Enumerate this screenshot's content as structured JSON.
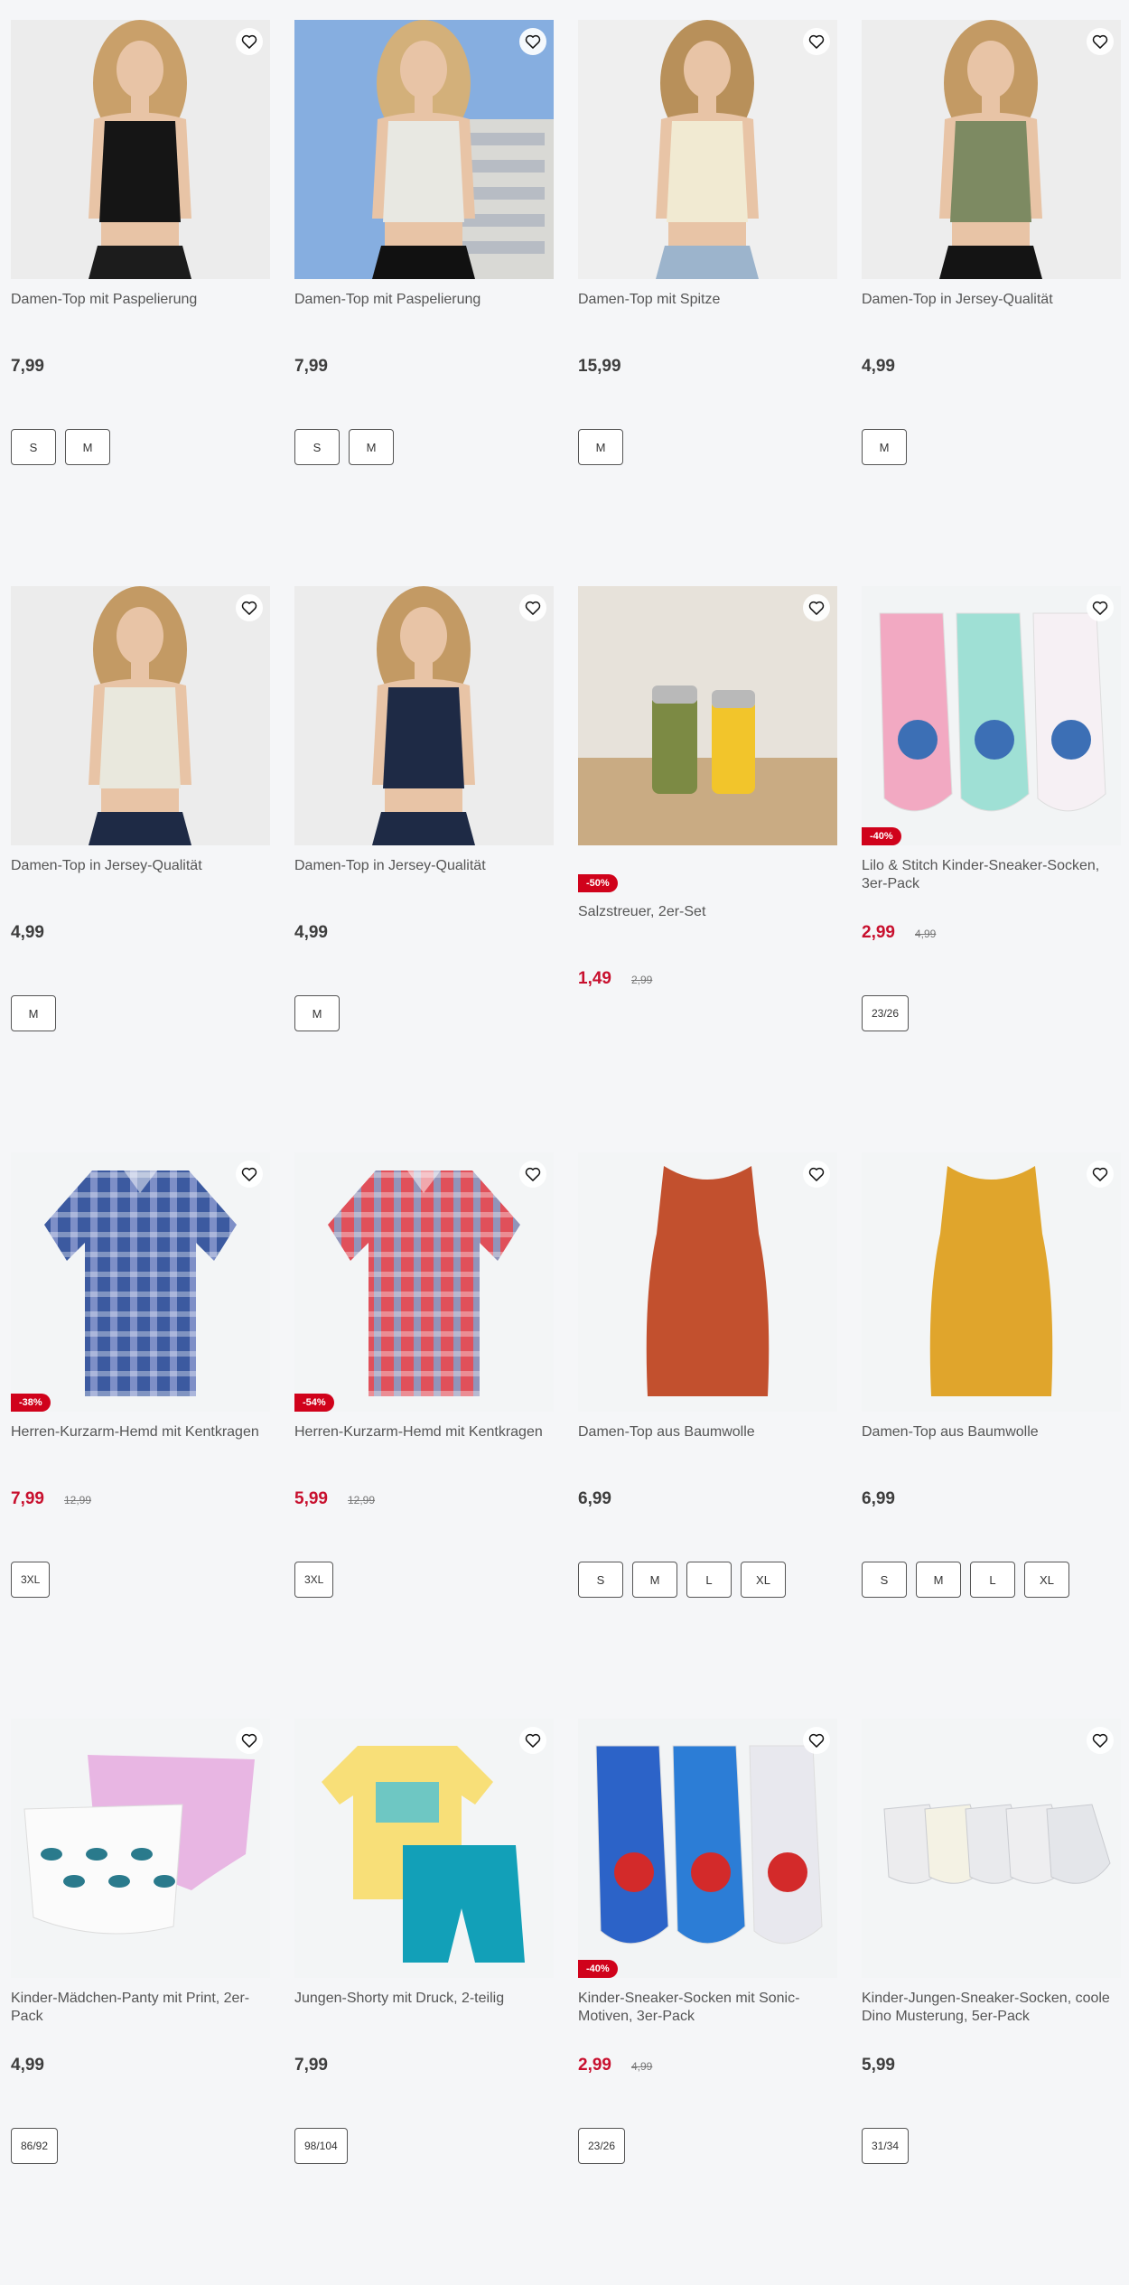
{
  "products": [
    {
      "name": "Damen-Top mit Paspelierung",
      "price": "7,99",
      "old_price": "",
      "discount": "",
      "sizes": [
        "S",
        "M"
      ],
      "image": "woman-black-crop-top"
    },
    {
      "name": "Damen-Top mit Paspelierung",
      "price": "7,99",
      "old_price": "",
      "discount": "",
      "sizes": [
        "S",
        "M"
      ],
      "image": "woman-white-crop-top-outdoor"
    },
    {
      "name": "Damen-Top mit Spitze",
      "price": "15,99",
      "old_price": "",
      "discount": "",
      "sizes": [
        "M"
      ],
      "image": "woman-lace-top-jeans"
    },
    {
      "name": "Damen-Top in Jersey-Qualität",
      "price": "4,99",
      "old_price": "",
      "discount": "",
      "sizes": [
        "M"
      ],
      "image": "woman-olive-crop-top"
    },
    {
      "name": "Damen-Top in Jersey-Qualität",
      "price": "4,99",
      "old_price": "",
      "discount": "",
      "sizes": [
        "M"
      ],
      "image": "woman-cream-crop-top"
    },
    {
      "name": "Damen-Top in Jersey-Qualität",
      "price": "4,99",
      "old_price": "",
      "discount": "",
      "sizes": [
        "M"
      ],
      "image": "woman-navy-crop-top"
    },
    {
      "name": "Salzstreuer, 2er-Set",
      "price": "1,49",
      "old_price": "2,99",
      "discount": "-50%",
      "discount_outside": true,
      "sizes": [],
      "image": "salt-shakers"
    },
    {
      "name": "Lilo & Stitch Kinder-Sneaker-Socken, 3er-Pack",
      "price": "2,99",
      "old_price": "4,99",
      "discount": "-40%",
      "sizes": [
        "23/26"
      ],
      "image": "stitch-socks"
    },
    {
      "name": "Herren-Kurzarm-Hemd mit Kentkragen",
      "price": "7,99",
      "old_price": "12,99",
      "discount": "-38%",
      "sizes": [
        "3XL"
      ],
      "image": "blue-plaid-shirt"
    },
    {
      "name": "Herren-Kurzarm-Hemd mit Kentkragen",
      "price": "5,99",
      "old_price": "12,99",
      "discount": "-54%",
      "sizes": [
        "3XL"
      ],
      "image": "red-plaid-shirt"
    },
    {
      "name": "Damen-Top aus Baumwolle",
      "price": "6,99",
      "old_price": "",
      "discount": "",
      "sizes": [
        "S",
        "M",
        "L",
        "XL"
      ],
      "image": "rust-tank-top"
    },
    {
      "name": "Damen-Top aus Baumwolle",
      "price": "6,99",
      "old_price": "",
      "discount": "",
      "sizes": [
        "S",
        "M",
        "L",
        "XL"
      ],
      "image": "mustard-tank-top"
    },
    {
      "name": "Kinder-Mädchen-Panty mit Print, 2er-Pack",
      "price": "4,99",
      "old_price": "",
      "discount": "",
      "sizes": [
        "86/92"
      ],
      "image": "girls-panties"
    },
    {
      "name": "Jungen-Shorty mit Druck, 2-teilig",
      "price": "7,99",
      "old_price": "",
      "discount": "",
      "sizes": [
        "98/104"
      ],
      "image": "boys-shorty-set"
    },
    {
      "name": "Kinder-Sneaker-Socken mit Sonic-Motiven, 3er-Pack",
      "price": "2,99",
      "old_price": "4,99",
      "discount": "-40%",
      "sizes": [
        "23/26"
      ],
      "image": "sonic-socks"
    },
    {
      "name": "Kinder-Jungen-Sneaker-Socken, coole Dino Musterung, 5er-Pack",
      "price": "5,99",
      "old_price": "",
      "discount": "",
      "sizes": [
        "31/34"
      ],
      "image": "dino-socks"
    }
  ],
  "colors": {
    "sale": "#c8102e",
    "badge": "#d0021b",
    "background": "#f5f6f8"
  },
  "icons": {
    "wishlist": "heart-outline-icon"
  }
}
